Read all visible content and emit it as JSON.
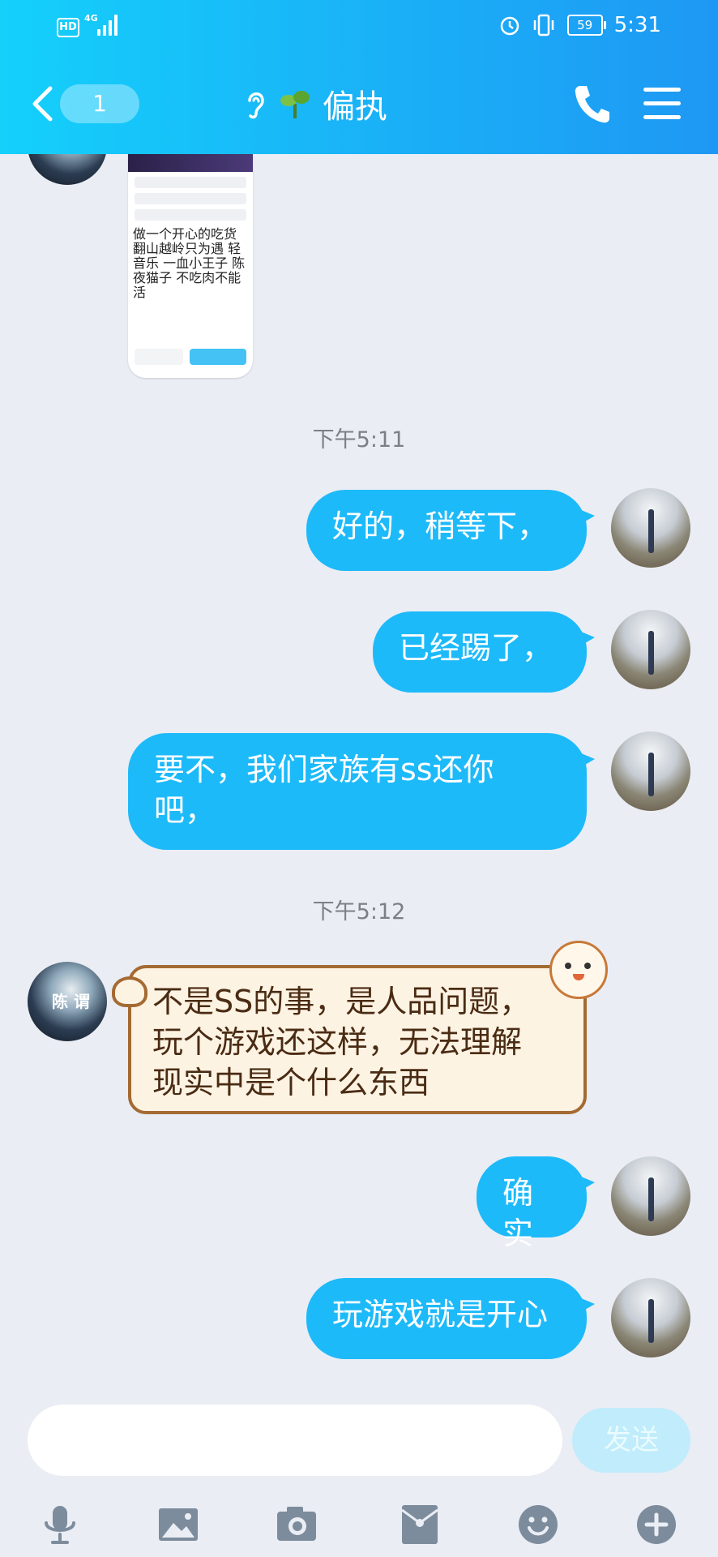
{
  "status_bar": {
    "hd": "HD",
    "network": "4G",
    "battery": "59",
    "time": "5:31"
  },
  "nav": {
    "unread_count": "1",
    "title": "偏执"
  },
  "shared_card_tags": "做一个开心的吃货 翻山越岭只为遇 轻音乐 一血小王子 陈 夜猫子 不吃肉不能活",
  "timestamps": [
    "下午5:11",
    "下午5:12"
  ],
  "messages": [
    {
      "from": "me",
      "text": "好的，稍等下，"
    },
    {
      "from": "me",
      "text": "已经踢了，"
    },
    {
      "from": "me",
      "text": "要不，我们家族有ss还你\n吧，"
    },
    {
      "from": "peer",
      "text": "不是SS的事，是人品问题，\n玩个游戏还这样，无法理解\n现实中是个什么东西"
    },
    {
      "from": "me",
      "text": "确实"
    },
    {
      "from": "me",
      "text": "玩游戏就是开心"
    }
  ],
  "peer_avatar_text": "陈 谓",
  "input": {
    "placeholder": "",
    "send_label": "发送"
  },
  "toolbar_icons": [
    "microphone-icon",
    "image-icon",
    "camera-icon",
    "red-packet-icon",
    "emoji-icon",
    "plus-icon"
  ],
  "colors": {
    "accent": "#1dbafa",
    "header_start": "#14d0fb",
    "header_end": "#1e98f4",
    "background": "#eaedf4"
  }
}
